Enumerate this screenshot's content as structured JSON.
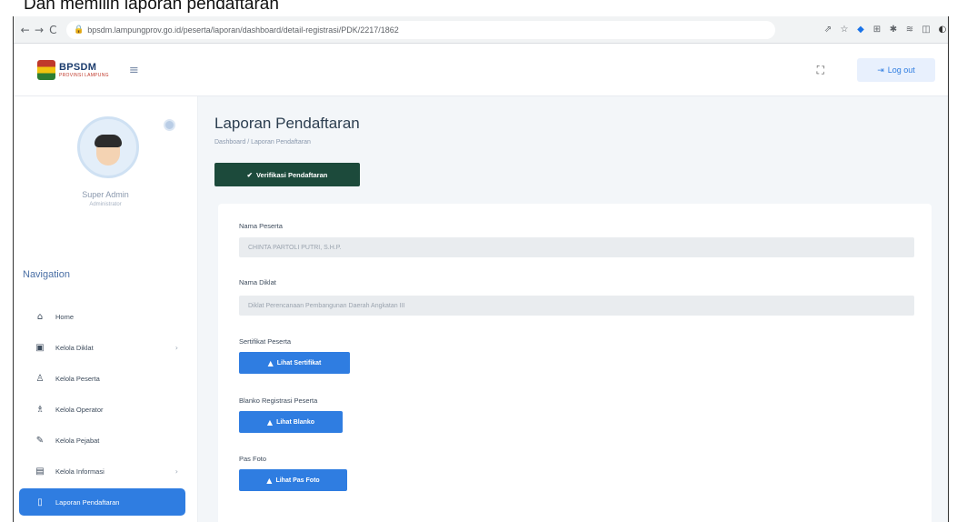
{
  "caption": "Dan memilih laporan pendaftaran",
  "browser": {
    "url": "bpsdm.lampungprov.go.id/peserta/laporan/dashboard/detail-registrasi/PDK/2217/1862",
    "back": "←",
    "forward": "→",
    "reload": "C",
    "lock": "🔒",
    "ext_icons": [
      "⇗",
      "☆",
      "◆",
      "⊞",
      "✱",
      "≋",
      "◫",
      "◐"
    ]
  },
  "header": {
    "logo_title": "BPSDM",
    "logo_sub": "PROVINSI LAMPUNG",
    "hamburger": "≡",
    "fullscreen": "⛶",
    "logout_icon": "⇥",
    "logout_label": "Log out"
  },
  "sidebar": {
    "user_name": "Super Admin",
    "user_role": "Administrator",
    "nav_title": "Navigation",
    "items": [
      {
        "icon": "⌂",
        "label": "Home",
        "chevron": ""
      },
      {
        "icon": "▣",
        "label": "Kelola Diklat",
        "chevron": "›"
      },
      {
        "icon": "♙",
        "label": "Kelola Peserta",
        "chevron": ""
      },
      {
        "icon": "♗",
        "label": "Kelola Operator",
        "chevron": ""
      },
      {
        "icon": "✎",
        "label": "Kelola Pejabat",
        "chevron": ""
      },
      {
        "icon": "▤",
        "label": "Kelola Informasi",
        "chevron": "›"
      },
      {
        "icon": "▯",
        "label": "Laporan Pendaftaran",
        "chevron": ""
      }
    ]
  },
  "main": {
    "title": "Laporan Pendaftaran",
    "breadcrumb": "Dashboard / Laporan Pendaftaran",
    "verify_check": "✔",
    "verify_label": "Verifikasi Pendaftaran",
    "fields": {
      "nama_peserta_label": "Nama Peserta",
      "nama_peserta_value": "CHINTA PARTOLI PUTRI, S.H.P.",
      "nama_diklat_label": "Nama Diklat",
      "nama_diklat_value": "Diklat Perencanaan Pembangunan Daerah Angkatan III",
      "sertifikat_label": "Sertifikat Peserta",
      "sertifikat_btn": "Lihat Sertifikat",
      "blanko_label": "Blanko Registrasi Peserta",
      "blanko_btn": "Lihat Blanko",
      "pasfoto_label": "Pas Foto",
      "pasfoto_btn": "Lihat Pas Foto",
      "upload_icon": "▲"
    }
  }
}
